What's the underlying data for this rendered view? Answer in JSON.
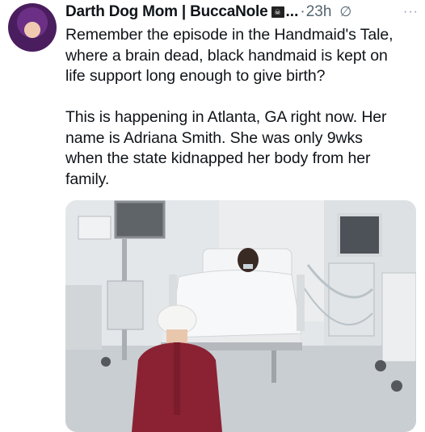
{
  "post": {
    "author_name": "Darth Dog Mom | BuccaNole",
    "author_badge_icon": "pirate-flag-icon",
    "ellipsis": "...",
    "separator": "·",
    "timestamp": "23h",
    "status_icon": "no-entry-icon",
    "more_icon": "more-options-icon",
    "more_label": "···",
    "paragraphs": [
      "Remember the episode in the Handmaid's Tale,\nwhere a brain dead, black handmaid is kept on\nlife support long enough to give birth?",
      "This is happening in Atlanta, GA right now. Her\nname is Adriana Smith. She was only 9wks\nwhen the state kidnapped her body from her\nfamily."
    ]
  }
}
